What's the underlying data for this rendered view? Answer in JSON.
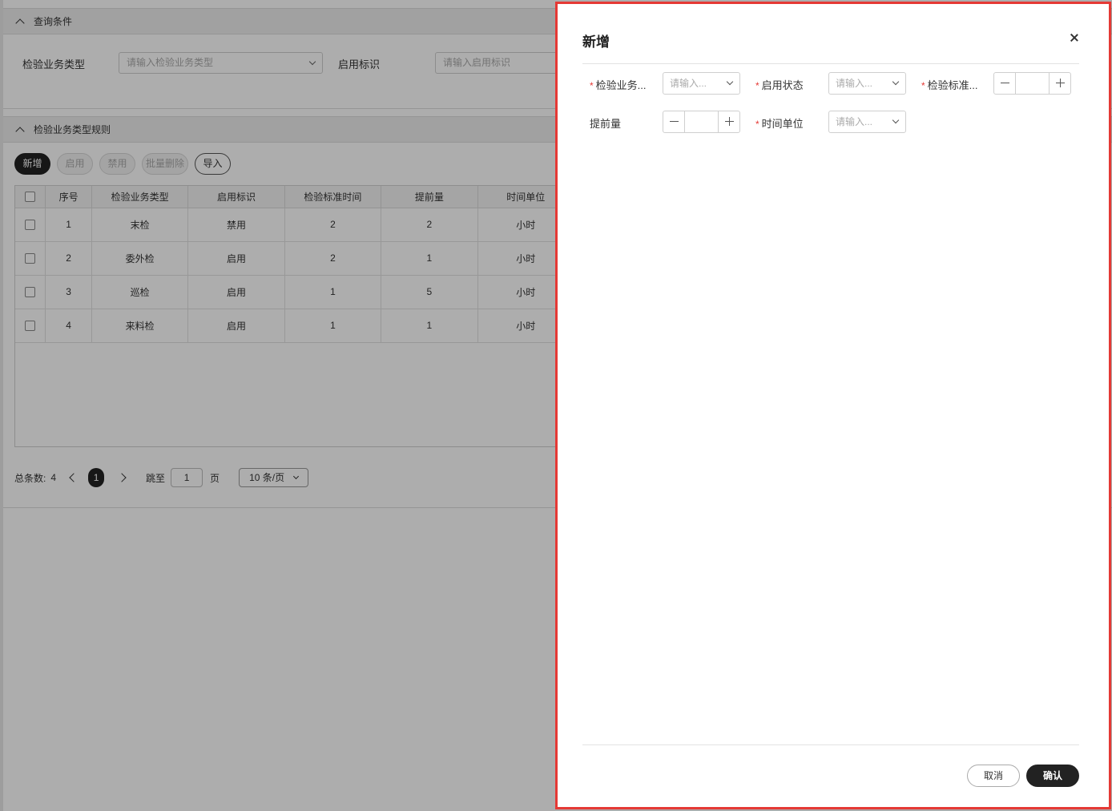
{
  "query_section": {
    "title": "查询条件",
    "fields": [
      {
        "label": "检验业务类型",
        "placeholder": "请输入检验业务类型"
      },
      {
        "label": "启用标识",
        "placeholder": "请输入启用标识"
      }
    ]
  },
  "rules_section": {
    "title": "检验业务类型规则",
    "toolbar": {
      "add": "新增",
      "enable": "启用",
      "disable": "禁用",
      "batch_delete": "批量删除",
      "import": "导入"
    },
    "table": {
      "columns": [
        "序号",
        "检验业务类型",
        "启用标识",
        "检验标准时间",
        "提前量",
        "时间单位"
      ],
      "rows": [
        {
          "no": "1",
          "type": "末检",
          "flag": "禁用",
          "std_time": "2",
          "lead": "2",
          "unit": "小时"
        },
        {
          "no": "2",
          "type": "委外检",
          "flag": "启用",
          "std_time": "2",
          "lead": "1",
          "unit": "小时"
        },
        {
          "no": "3",
          "type": "巡检",
          "flag": "启用",
          "std_time": "1",
          "lead": "5",
          "unit": "小时"
        },
        {
          "no": "4",
          "type": "来料检",
          "flag": "启用",
          "std_time": "1",
          "lead": "1",
          "unit": "小时"
        }
      ]
    },
    "pagination": {
      "total_label": "总条数:",
      "total": "4",
      "current_page": "1",
      "jump_label": "跳至",
      "jump_value": "1",
      "page_suffix": "页",
      "page_size": "10 条/页"
    }
  },
  "drawer": {
    "title": "新增",
    "fields": {
      "business_type": {
        "label": "检验业务...",
        "placeholder": "请输入...",
        "required": "*"
      },
      "enable_status": {
        "label": "启用状态",
        "placeholder": "请输入...",
        "required": "*"
      },
      "std_time": {
        "label": "检验标准...",
        "required": "*"
      },
      "lead": {
        "label": "提前量"
      },
      "time_unit": {
        "label": "时间单位",
        "placeholder": "请输入...",
        "required": "*"
      }
    },
    "cancel": "取消",
    "confirm": "确认"
  },
  "colors": {
    "accent": "#222222",
    "required": "#e53935",
    "highlight_border": "#e53935"
  }
}
